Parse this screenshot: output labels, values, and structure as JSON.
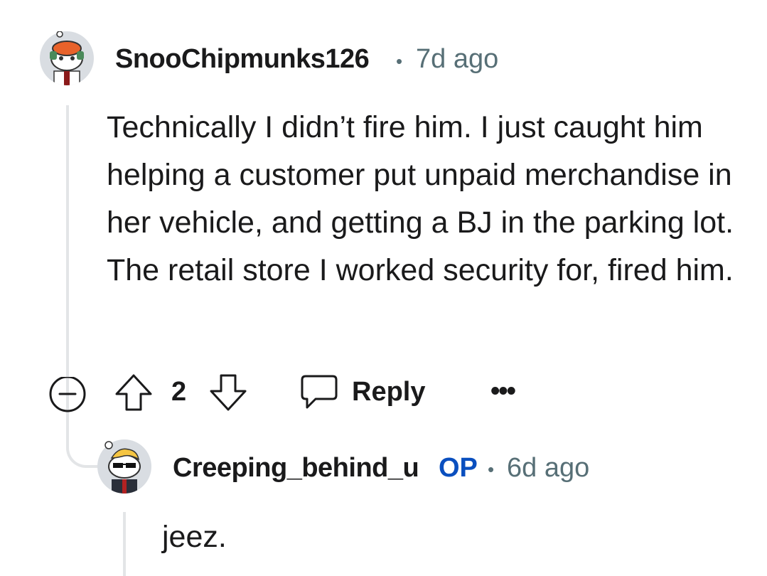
{
  "comment": {
    "author": "SnooChipmunks126",
    "separator": "•",
    "time": "7d ago",
    "body": "Technically I didn’t fire him. I just caught him helping a customer put unpaid merchandise in her vehicle, and getting a BJ in the parking lot. The retail store I worked security for, fired him.",
    "score": "2",
    "reply_label": "Reply",
    "more_label": "•••",
    "avatar_icon": "snoo-avatar-icon"
  },
  "reply": {
    "author": "Creeping_behind_u",
    "op_badge": "OP",
    "separator": "•",
    "time": "6d ago",
    "body": "jeez.",
    "avatar_icon": "snoo-avatar-sunglasses-icon"
  },
  "colors": {
    "meta": "#576f76",
    "op": "#0a4fbf",
    "thread_line": "#e3e5e7",
    "text": "#1a1a1b"
  }
}
